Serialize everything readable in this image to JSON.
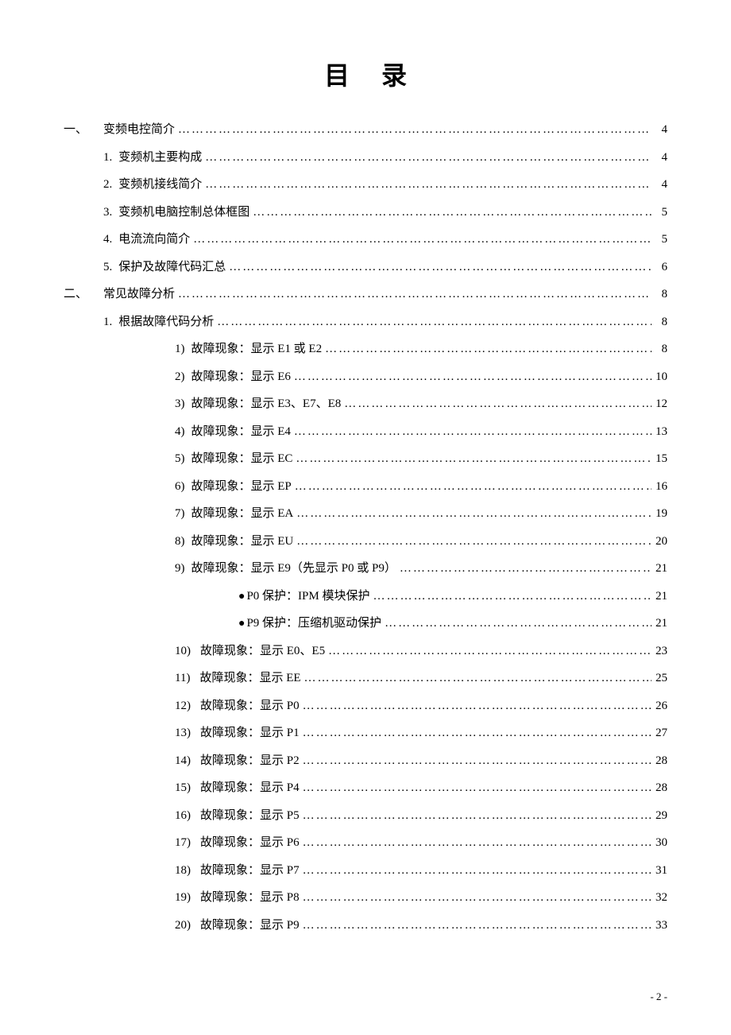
{
  "title": "目录",
  "footer": "- 2 -",
  "toc": [
    {
      "level": 0,
      "section": "一、",
      "num": "",
      "text": "变频电控简介",
      "page": "4"
    },
    {
      "level": 1,
      "section": "",
      "num": "1.",
      "text": "变频机主要构成",
      "page": "4"
    },
    {
      "level": 1,
      "section": "",
      "num": "2.",
      "text": "变频机接线简介",
      "page": "4"
    },
    {
      "level": 1,
      "section": "",
      "num": "3.",
      "text": "变频机电脑控制总体框图",
      "page": "5"
    },
    {
      "level": 1,
      "section": "",
      "num": "4.",
      "text": "电流流向简介",
      "page": "5"
    },
    {
      "level": 1,
      "section": "",
      "num": "5.",
      "text": "保护及故障代码汇总",
      "page": "6"
    },
    {
      "level": 0,
      "section": "二、",
      "num": "",
      "text": "常见故障分析",
      "page": "8"
    },
    {
      "level": 1,
      "section": "",
      "num": "1.",
      "text": "根据故障代码分析",
      "page": "8"
    },
    {
      "level": 2,
      "section": "",
      "num": "1)",
      "text": "故障现象：显示 E1 或 E2",
      "page": "8"
    },
    {
      "level": 2,
      "section": "",
      "num": "2)",
      "text": "故障现象：显示 E6",
      "page": "10"
    },
    {
      "level": 2,
      "section": "",
      "num": "3)",
      "text": "故障现象：显示 E3、E7、E8",
      "page": "12"
    },
    {
      "level": 2,
      "section": "",
      "num": "4)",
      "text": "故障现象：显示 E4",
      "page": "13"
    },
    {
      "level": 2,
      "section": "",
      "num": "5)",
      "text": "故障现象：显示 EC",
      "page": "15"
    },
    {
      "level": 2,
      "section": "",
      "num": "6)",
      "text": "故障现象：显示 EP",
      "page": "16"
    },
    {
      "level": 2,
      "section": "",
      "num": "7)",
      "text": "故障现象：显示 EA",
      "page": "19"
    },
    {
      "level": 2,
      "section": "",
      "num": "8)",
      "text": "故障现象：显示 EU",
      "page": "20"
    },
    {
      "level": 2,
      "section": "",
      "num": "9)",
      "text": "故障现象：显示 E9（先显示 P0 或 P9）",
      "page": "21"
    },
    {
      "level": 3,
      "section": "",
      "num": "●",
      "text": "P0 保护：IPM 模块保护",
      "page": "21",
      "bullet": true
    },
    {
      "level": 3,
      "section": "",
      "num": "●",
      "text": "P9 保护：压缩机驱动保护",
      "page": "21",
      "bullet": true
    },
    {
      "level": 2,
      "section": "",
      "num": "10)",
      "text": "故障现象：显示 E0、E5",
      "page": "23",
      "double": true
    },
    {
      "level": 2,
      "section": "",
      "num": "11)",
      "text": "故障现象：显示 EE",
      "page": "25",
      "double": true
    },
    {
      "level": 2,
      "section": "",
      "num": "12)",
      "text": "故障现象：显示 P0",
      "page": "26",
      "double": true
    },
    {
      "level": 2,
      "section": "",
      "num": "13)",
      "text": "故障现象：显示 P1",
      "page": "27",
      "double": true
    },
    {
      "level": 2,
      "section": "",
      "num": "14)",
      "text": "故障现象：显示 P2",
      "page": "28",
      "double": true
    },
    {
      "level": 2,
      "section": "",
      "num": "15)",
      "text": "故障现象：显示 P4",
      "page": "28",
      "double": true
    },
    {
      "level": 2,
      "section": "",
      "num": "16)",
      "text": "故障现象：显示 P5",
      "page": "29",
      "double": true
    },
    {
      "level": 2,
      "section": "",
      "num": "17)",
      "text": "故障现象：显示 P6",
      "page": "30",
      "double": true
    },
    {
      "level": 2,
      "section": "",
      "num": "18)",
      "text": "故障现象：显示 P7",
      "page": "31",
      "double": true
    },
    {
      "level": 2,
      "section": "",
      "num": "19)",
      "text": "故障现象：显示 P8",
      "page": "32",
      "double": true
    },
    {
      "level": 2,
      "section": "",
      "num": "20)",
      "text": "故障现象：显示 P9",
      "page": "33",
      "double": true
    }
  ]
}
